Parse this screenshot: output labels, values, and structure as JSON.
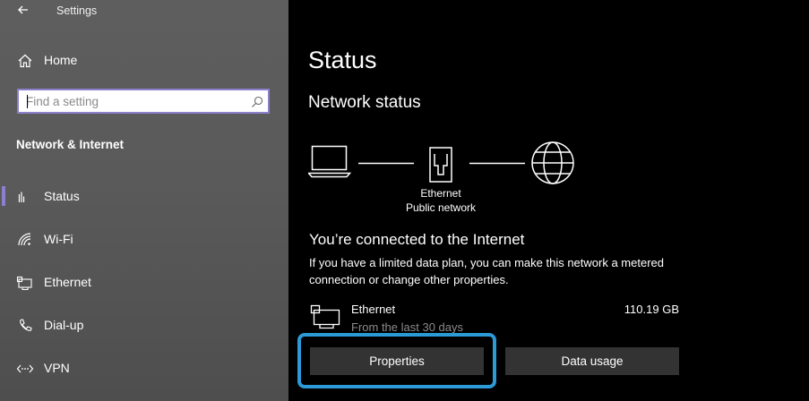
{
  "window": {
    "title": "Settings"
  },
  "sidebar": {
    "home_label": "Home",
    "search_placeholder": "Find a setting",
    "section_title": "Network & Internet",
    "items": [
      {
        "label": "Status",
        "icon": "home-status-icon",
        "active": true
      },
      {
        "label": "Wi-Fi",
        "icon": "wifi-icon"
      },
      {
        "label": "Ethernet",
        "icon": "ethernet-icon"
      },
      {
        "label": "Dial-up",
        "icon": "dialup-icon"
      },
      {
        "label": "VPN",
        "icon": "vpn-icon"
      }
    ]
  },
  "main": {
    "title": "Status",
    "network_status_heading": "Network status",
    "diagram": {
      "adapter_name": "Ethernet",
      "network_type": "Public network"
    },
    "connection_heading": "You’re connected to the Internet",
    "description": "If you have a limited data plan, you can make this network a metered connection or change other properties.",
    "usage": {
      "name": "Ethernet",
      "period": "From the last 30 days",
      "amount": "110.19 GB"
    },
    "buttons": {
      "properties": "Properties",
      "data_usage": "Data usage"
    }
  },
  "colors": {
    "accent": "#8d7fcc",
    "highlight": "#2c9ad6"
  }
}
